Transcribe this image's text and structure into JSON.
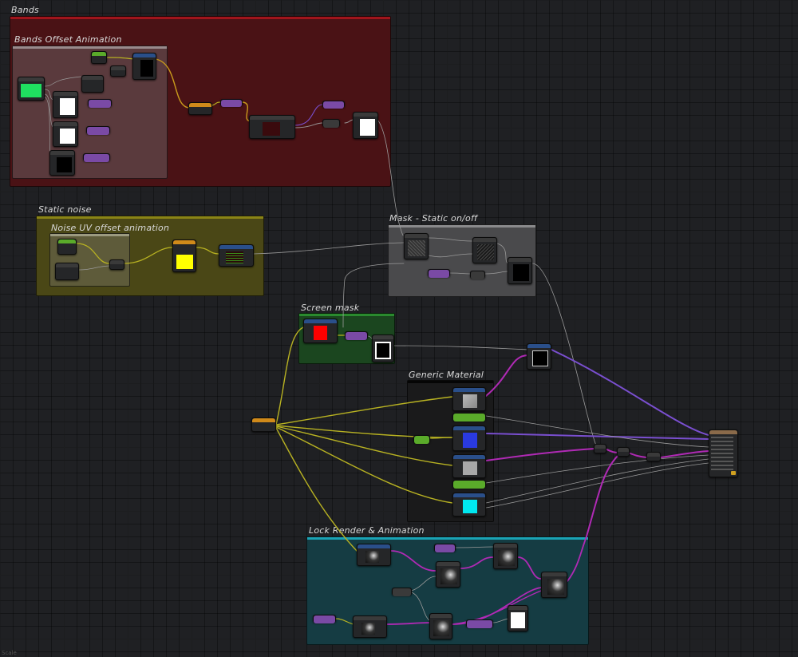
{
  "comments": {
    "bands": "Bands",
    "bands_offset": "Bands Offset Animation",
    "static_noise": "Static noise",
    "noise_uv": "Noise UV offset animation",
    "mask_static": "Mask - Static on/off",
    "screen_mask": "Screen mask",
    "generic_material": "Generic Material",
    "lock_render": "Lock Render & Animation"
  },
  "colors": {
    "bands_fill": "#4a1215",
    "bands_inner": "#5a3a3d",
    "static_fill": "#4a4716",
    "static_inner": "#5e5b3a",
    "mask_fill": "#4a4a4c",
    "screen_fill": "#1b461f",
    "generic_fill": "#1a1a1b",
    "lock_fill": "#153c43",
    "wire_yellow": "#b8b222",
    "wire_magenta": "#b02ab5",
    "wire_purple": "#7a4fd0",
    "wire_grey": "#9a9a9a",
    "wire_orange": "#c99a1c"
  },
  "watermark": "Scale"
}
